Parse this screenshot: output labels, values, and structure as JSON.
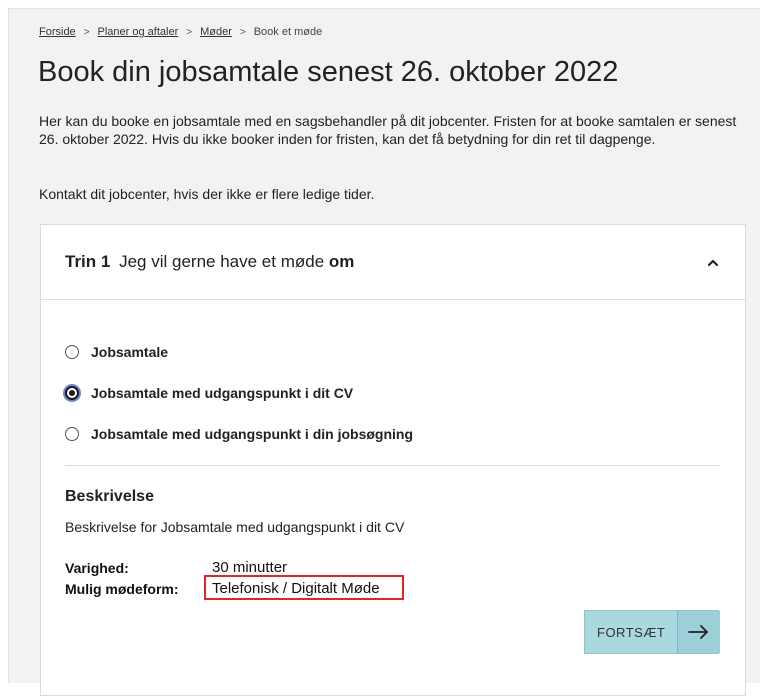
{
  "breadcrumb": {
    "items": [
      "Forside",
      "Planer og aftaler",
      "Møder"
    ],
    "current": "Book et møde",
    "separator": ">"
  },
  "title": "Book din jobsamtale senest 26. oktober 2022",
  "intro": "Her kan du booke en jobsamtale med en sagsbehandler på dit jobcenter. Fristen for at booke samtalen er senest 26. oktober 2022. Hvis du ikke booker inden for fristen, kan det få betydning for din ret til dagpenge.",
  "contact": "Kontakt dit jobcenter, hvis der ikke er flere ledige tider.",
  "step": {
    "number": "Trin 1",
    "text": "Jeg vil gerne have et møde",
    "bold": "om",
    "toggle_icon": "chevron-up-icon"
  },
  "options": [
    {
      "label": "Jobsamtale",
      "selected": false
    },
    {
      "label": "Jobsamtale med udgangspunkt i dit CV",
      "selected": true
    },
    {
      "label": "Jobsamtale med udgangspunkt i din jobsøgning",
      "selected": false
    }
  ],
  "description": {
    "heading": "Beskrivelse",
    "text": "Beskrivelse for Jobsamtale med udgangspunkt i dit CV"
  },
  "details": {
    "duration_label": "Varighed:",
    "duration_value": "30 minutter",
    "format_label": "Mulig mødeform:",
    "format_value": "Telefonisk / Digitalt Møde"
  },
  "continue_button": {
    "label": "FORTSÆT",
    "icon": "arrow-right-icon"
  },
  "colors": {
    "background": "#f2f2f2",
    "button": "#a9d8df",
    "highlight": "#e0252b",
    "focus_ring": "#6d88c6"
  }
}
